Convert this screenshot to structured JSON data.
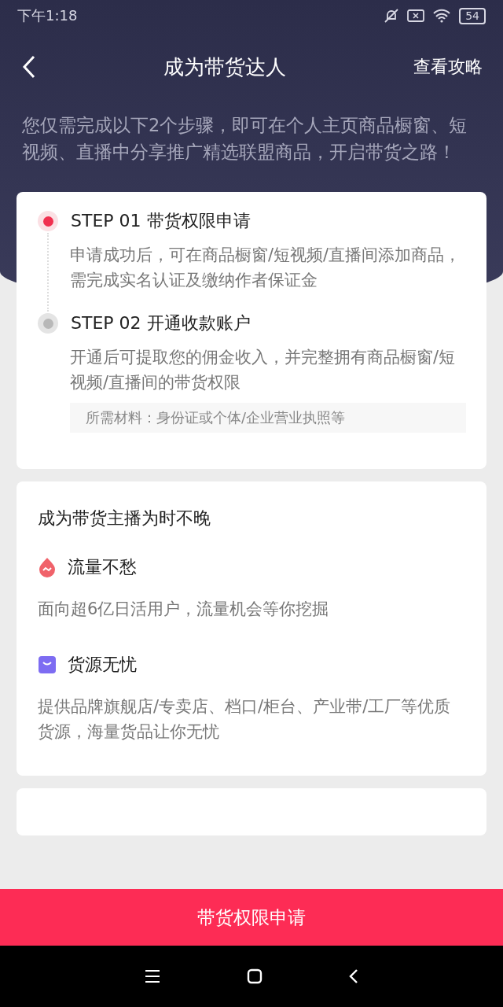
{
  "status_bar": {
    "time": "下午1:18",
    "battery": "54"
  },
  "nav": {
    "title": "成为带货达人",
    "action": "查看攻略"
  },
  "intro": "您仅需完成以下2个步骤，即可在个人主页商品橱窗、短视频、直播中分享推广精选联盟商品，开启带货之路！",
  "steps": [
    {
      "title": "STEP 01 带货权限申请",
      "desc": "申请成功后，可在商品橱窗/短视频/直播间添加商品，需完成实名认证及缴纳作者保证金",
      "active": true
    },
    {
      "title": "STEP 02 开通收款账户",
      "desc": "开通后可提取您的佣金收入，并完整拥有商品橱窗/短视频/直播间的带货权限",
      "note": "所需材料：身份证或个体/企业营业执照等",
      "active": false
    }
  ],
  "benefits": {
    "title": "成为带货主播为时不晚",
    "items": [
      {
        "kind": "traffic",
        "title": "流量不愁",
        "desc": "面向超6亿日活用户，流量机会等你挖掘"
      },
      {
        "kind": "goods",
        "title": "货源无忧",
        "desc": "提供品牌旗舰店/专卖店、档口/柜台、产业带/工厂等优质货源，海量货品让你无忧"
      }
    ]
  },
  "apply_button": "带货权限申请"
}
